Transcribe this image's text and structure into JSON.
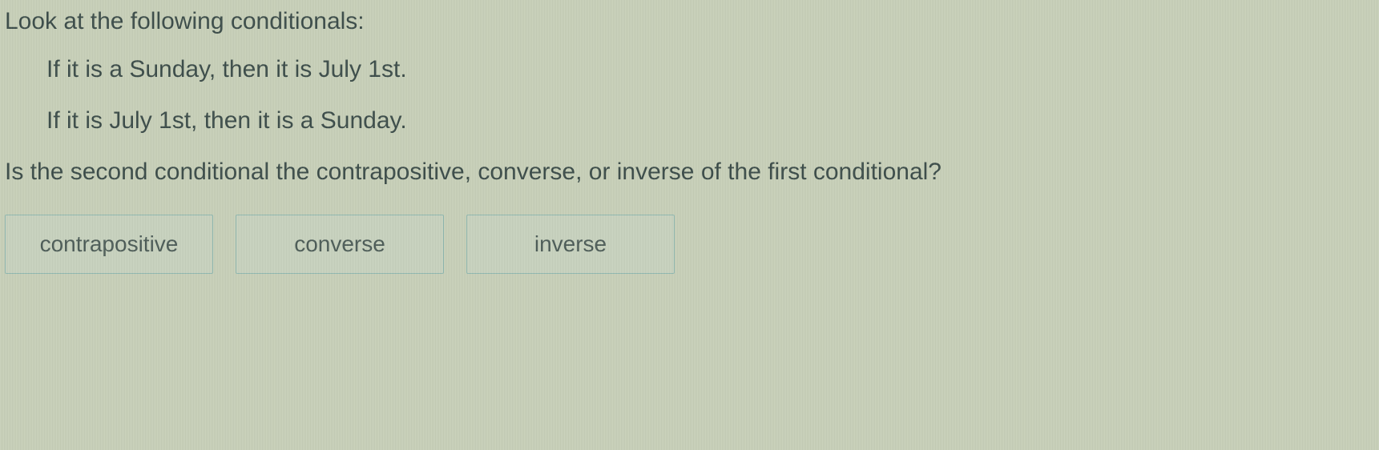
{
  "prompt": "Look at the following conditionals:",
  "conditionals": [
    "If it is a Sunday, then it is July 1st.",
    "If it is July 1st, then it is a Sunday."
  ],
  "question": "Is the second conditional the contrapositive, converse, or inverse of the first conditional?",
  "options": [
    {
      "label": "contrapositive"
    },
    {
      "label": "converse"
    },
    {
      "label": "inverse"
    }
  ]
}
